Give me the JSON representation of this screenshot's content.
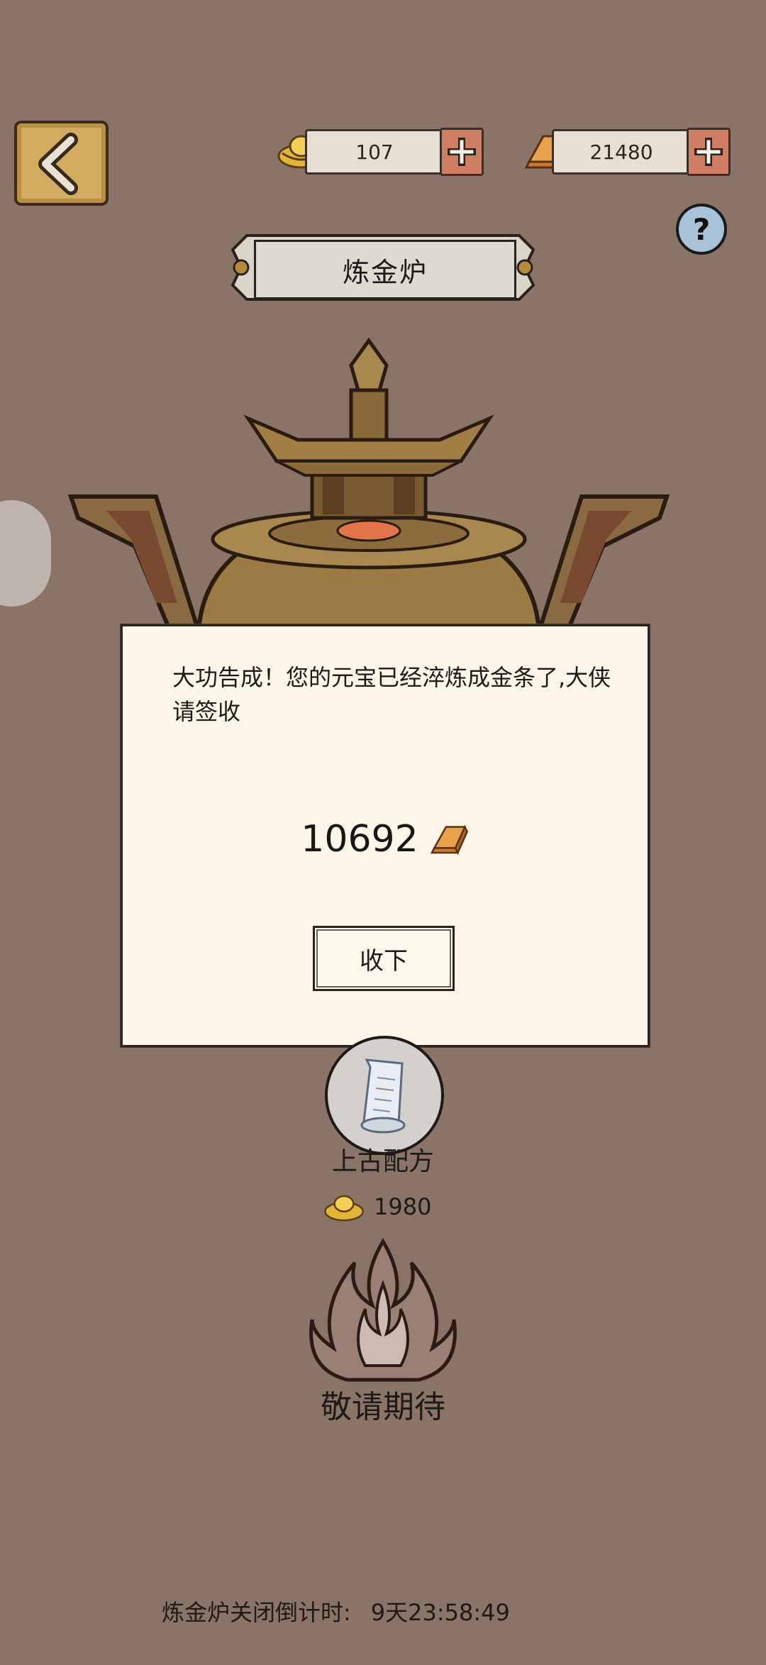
{
  "resources": {
    "yuanbao": {
      "value": "107",
      "icon": "gold-ingot-icon"
    },
    "gold_bar": {
      "value": "21480",
      "icon": "gold-bar-icon"
    }
  },
  "header": {
    "title": "炼金炉",
    "help_label": "?"
  },
  "dialog": {
    "message": "大功告成！您的元宝已经淬炼成金条了,大侠请签收",
    "reward_amount": "10692",
    "accept_label": "收下"
  },
  "recipe": {
    "label": "上古配方",
    "cost": "1980"
  },
  "coming_soon": {
    "label": "敬请期待"
  },
  "countdown": {
    "label": "炼金炉关闭倒计时:",
    "value": "9天23:58:49"
  },
  "colors": {
    "background": "#8a7367",
    "dialog_bg": "#fbf6e7",
    "plus_button": "#cf7e64",
    "back_button": "#d4ac61",
    "help_button": "#a8c2d7"
  }
}
